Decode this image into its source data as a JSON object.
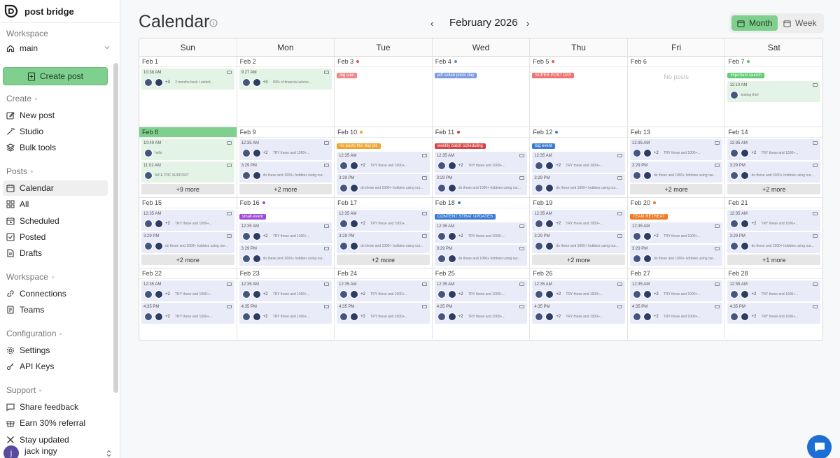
{
  "brand": {
    "name": "post bridge"
  },
  "sidebar": {
    "workspace_label": "Workspace",
    "workspace_value": "main",
    "create_post": "Create post",
    "sections": [
      {
        "title": "Create",
        "items": [
          {
            "label": "New post",
            "icon": "pencil-square-icon"
          },
          {
            "label": "Studio",
            "icon": "wand-icon"
          },
          {
            "label": "Bulk tools",
            "icon": "layers-icon"
          }
        ]
      },
      {
        "title": "Posts",
        "items": [
          {
            "label": "Calendar",
            "icon": "calendar-icon",
            "active": true
          },
          {
            "label": "All",
            "icon": "grid-icon"
          },
          {
            "label": "Scheduled",
            "icon": "calendar-clock-icon"
          },
          {
            "label": "Posted",
            "icon": "check-square-icon"
          },
          {
            "label": "Drafts",
            "icon": "document-icon"
          }
        ]
      },
      {
        "title": "Workspace",
        "items": [
          {
            "label": "Connections",
            "icon": "link-icon"
          },
          {
            "label": "Teams",
            "icon": "id-card-icon"
          }
        ]
      },
      {
        "title": "Configuration",
        "items": [
          {
            "label": "Settings",
            "icon": "gear-icon"
          },
          {
            "label": "API Keys",
            "icon": "key-icon"
          }
        ]
      },
      {
        "title": "Support",
        "items": [
          {
            "label": "Share feedback",
            "icon": "message-icon"
          },
          {
            "label": "Earn 30% referral",
            "icon": "gift-icon"
          },
          {
            "label": "Stay updated",
            "icon": "x-logo-icon"
          }
        ]
      }
    ],
    "user": {
      "initial": "j",
      "name": "jack ingy"
    }
  },
  "header": {
    "title": "Calendar",
    "month": "February 2026",
    "prev": "‹",
    "next": "›",
    "views": [
      "Month",
      "Week"
    ],
    "active_view": "Month"
  },
  "calendar": {
    "day_names": [
      "Sun",
      "Mon",
      "Tue",
      "Wed",
      "Thu",
      "Fri",
      "Sat"
    ],
    "no_posts": "No posts",
    "weeks": [
      [
        {
          "date": "Feb 1",
          "posts": [
            {
              "time": "10:38 AM",
              "plus": "+3",
              "caption": "3 months back I added...",
              "green": true
            }
          ]
        },
        {
          "date": "Feb 2",
          "posts": [
            {
              "time": "9:27 AM",
              "plus": "+3",
              "caption": "99% of financial advice...",
              "green": true
            }
          ]
        },
        {
          "date": "Feb 3",
          "dot": "#e25b5b",
          "event": {
            "label": "big sale",
            "color": "#ee8787"
          }
        },
        {
          "date": "Feb 4",
          "dot": "#6b86d8",
          "event": {
            "label": "jeff collab posts day",
            "color": "#7b9be3"
          }
        },
        {
          "date": "Feb 5",
          "dot": "#e25b5b",
          "event": {
            "label": "SUPER POST DAY",
            "color": "#ef7373"
          }
        },
        {
          "date": "Feb 6",
          "empty": true
        },
        {
          "date": "Feb 7",
          "dot": "#5cc36d",
          "event": {
            "label": "important launch",
            "color": "#62cd77"
          },
          "posts": [
            {
              "time": "11:10 AM",
              "caption": "testing this!",
              "single": true,
              "green": true
            }
          ]
        }
      ],
      [
        {
          "date": "Feb 8",
          "today": true,
          "posts": [
            {
              "time": "10:49 AM",
              "caption": "hello",
              "single": true,
              "green": true
            },
            {
              "time": "11:02 AM",
              "caption": "NICE PDF SUPPORT",
              "single": true,
              "green": true
            }
          ],
          "more": "+9 more"
        },
        {
          "date": "Feb 9",
          "posts": [
            {
              "time": "12:35 AM",
              "plus": "+2",
              "caption": "TRY these and 1000+..."
            },
            {
              "time": "3:29 PM",
              "caption": "do these and 1000+ hobbies using our..."
            }
          ],
          "more": "+2 more"
        },
        {
          "date": "Feb 10",
          "dot": "#f0a32c",
          "event": {
            "label": "no posts this day pls",
            "color": "#f0a32c"
          },
          "posts": [
            {
              "time": "12:35 AM",
              "plus": "+2",
              "caption": "TRY these and 1000+..."
            },
            {
              "time": "3:29 PM",
              "caption": "do these and 1000+ hobbies using our..."
            }
          ]
        },
        {
          "date": "Feb 11",
          "dot": "#d63b3b",
          "event": {
            "label": "weekly batch scheduling",
            "color": "#d64545"
          },
          "posts": [
            {
              "time": "12:35 AM",
              "plus": "+2",
              "caption": "TRY these and 1000+..."
            },
            {
              "time": "3:29 PM",
              "caption": "do these and 1000+ hobbies using our..."
            }
          ]
        },
        {
          "date": "Feb 12",
          "dot": "#3a7bd5",
          "event": {
            "label": "big event",
            "color": "#3a7bd5"
          },
          "posts": [
            {
              "time": "12:35 AM",
              "plus": "+2",
              "caption": "TRY these and 1000+..."
            },
            {
              "time": "3:29 PM",
              "caption": "do these and 1000+ hobbies using our..."
            }
          ]
        },
        {
          "date": "Feb 13",
          "posts": [
            {
              "time": "12:35 AM",
              "plus": "+2",
              "caption": "TRY these and 1000+..."
            },
            {
              "time": "3:29 PM",
              "caption": "do these and 1000+ hobbies using our..."
            }
          ],
          "more": "+2 more"
        },
        {
          "date": "Feb 14",
          "posts": [
            {
              "time": "12:35 AM",
              "plus": "+2",
              "caption": "TRY these and 1000+..."
            },
            {
              "time": "3:29 PM",
              "caption": "do these and 1000+ hobbies using our..."
            }
          ],
          "more": "+2 more"
        }
      ],
      [
        {
          "date": "Feb 15",
          "posts": [
            {
              "time": "12:35 AM",
              "plus": "+2",
              "caption": "TRY these and 1000+..."
            },
            {
              "time": "3:29 PM",
              "caption": "do these and 1000+ hobbies using our..."
            }
          ],
          "more": "+2 more"
        },
        {
          "date": "Feb 16",
          "dot": "#a04ad8",
          "event": {
            "label": "small event",
            "color": "#a04ad8"
          },
          "posts": [
            {
              "time": "12:35 AM",
              "plus": "+2",
              "caption": "TRY these and 1000+..."
            },
            {
              "time": "3:29 PM",
              "caption": "do these and 1000+ hobbies using our..."
            }
          ]
        },
        {
          "date": "Feb 17",
          "posts": [
            {
              "time": "12:35 AM",
              "plus": "+2",
              "caption": "TRY these and 1000+..."
            },
            {
              "time": "3:29 PM",
              "caption": "do these and 1000+ hobbies using our..."
            }
          ],
          "more": "+2 more"
        },
        {
          "date": "Feb 18",
          "dot": "#3a7bd5",
          "event": {
            "label": "CONTENT STRAT UPDATES",
            "color": "#3a7bd5"
          },
          "posts": [
            {
              "time": "12:35 AM",
              "plus": "+2",
              "caption": "TRY these and 1000+..."
            },
            {
              "time": "3:29 PM",
              "caption": "do these and 1000+ hobbies using our..."
            }
          ]
        },
        {
          "date": "Feb 19",
          "posts": [
            {
              "time": "12:35 AM",
              "plus": "+2",
              "caption": "TRY these and 1000+..."
            },
            {
              "time": "3:29 PM",
              "caption": "do these and 1000+ hobbies using our..."
            }
          ],
          "more": "+2 more"
        },
        {
          "date": "Feb 20",
          "dot": "#ef7a22",
          "event": {
            "label": "TEAM RETREAT",
            "color": "#ef7a22"
          },
          "posts": [
            {
              "time": "12:35 AM",
              "plus": "+2",
              "caption": "TRY these and 1000+..."
            },
            {
              "time": "3:29 PM",
              "caption": "do these and 1000+ hobbies using our..."
            }
          ]
        },
        {
          "date": "Feb 21",
          "posts": [
            {
              "time": "12:35 AM",
              "plus": "+2",
              "caption": "TRY these and 1000+..."
            },
            {
              "time": "3:29 PM",
              "caption": "do these and 1000+ hobbies using our..."
            }
          ],
          "more": "+1 more"
        }
      ],
      [
        {
          "date": "Feb 22",
          "posts": [
            {
              "time": "12:35 AM",
              "plus": "+2",
              "caption": "TRY these and 1000+..."
            },
            {
              "time": "4:35 PM",
              "plus": "+2",
              "caption": "TRY these and 1000+..."
            }
          ]
        },
        {
          "date": "Feb 23",
          "posts": [
            {
              "time": "12:35 AM",
              "plus": "+2",
              "caption": "TRY these and 1000+..."
            },
            {
              "time": "4:35 PM",
              "plus": "+2",
              "caption": "TRY these and 1000+..."
            }
          ]
        },
        {
          "date": "Feb 24",
          "posts": [
            {
              "time": "12:35 AM",
              "plus": "+2",
              "caption": "TRY these and 1000+..."
            },
            {
              "time": "4:35 PM",
              "plus": "+2",
              "caption": "TRY these and 1000+..."
            }
          ]
        },
        {
          "date": "Feb 25",
          "posts": [
            {
              "time": "12:35 AM",
              "plus": "+2",
              "caption": "TRY these and 1000+..."
            },
            {
              "time": "4:35 PM",
              "plus": "+2",
              "caption": "TRY these and 1000+..."
            }
          ]
        },
        {
          "date": "Feb 26",
          "posts": [
            {
              "time": "12:35 AM",
              "plus": "+2",
              "caption": "TRY these and 1000+..."
            },
            {
              "time": "4:35 PM",
              "plus": "+2",
              "caption": "TRY these and 1000+..."
            }
          ]
        },
        {
          "date": "Feb 27",
          "posts": [
            {
              "time": "12:35 AM",
              "plus": "+2",
              "caption": "TRY these and 1000+..."
            },
            {
              "time": "4:35 PM",
              "plus": "+2",
              "caption": "TRY these and 1000+..."
            }
          ]
        },
        {
          "date": "Feb 28",
          "posts": [
            {
              "time": "12:35 AM",
              "plus": "+2",
              "caption": "TRY these and 1000+..."
            },
            {
              "time": "4:35 PM",
              "plus": "+2",
              "caption": "TRY these and 1000+..."
            }
          ]
        }
      ]
    ]
  },
  "colors": {
    "accent": "#7fcf8f",
    "post_bg": "#e9ecf8"
  },
  "chat": {
    "icon": "chat-bubble-icon"
  }
}
